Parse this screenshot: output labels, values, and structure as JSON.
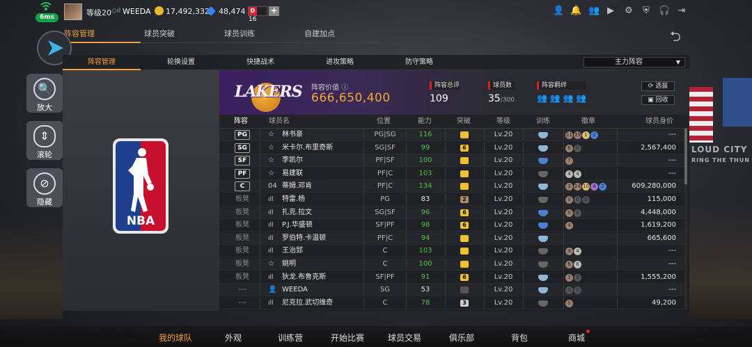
{
  "status": {
    "ping": "6ms"
  },
  "profile": {
    "level": "等级20",
    "username": "WEEDA",
    "badge_count": "16"
  },
  "currency": {
    "gold": "17,492,332",
    "diamonds": "48,474"
  },
  "main_tabs": [
    "阵容管理",
    "球员突破",
    "球员训练",
    "自建加点"
  ],
  "side_buttons": {
    "zoom": "放大",
    "scroll": "滚轮",
    "hide": "隐藏"
  },
  "sub_tabs": [
    "阵容管理",
    "轮换设置",
    "快捷战术",
    "进攻策略",
    "防守策略"
  ],
  "lineup_select": "主力阵容",
  "team": {
    "logo_text": "LAKERS",
    "value_label": "阵容价值",
    "value": "666,650,400",
    "rating_label": "阵容总评",
    "rating": "109",
    "count_label": "球员数",
    "count": "35",
    "count_max": "/300",
    "bond_label": "阵容羁绊",
    "btn_select": "选拔",
    "btn_recycle": "回收"
  },
  "table": {
    "headers": [
      "阵容",
      "球员名",
      "位置",
      "能力",
      "突破",
      "等级",
      "训练",
      "徽章",
      "球员身价"
    ],
    "rows": [
      {
        "slot": "PG",
        "tier": "☆",
        "name": "林书豪",
        "pos": "PG|SG",
        "ovr": "116",
        "ovr_color": "#52c24a",
        "brk": "",
        "brk_color": "#f0c030",
        "lv": "Lv.20",
        "train": "#8fb6d6",
        "badges": [
          [
            "11",
            "#9a8070"
          ],
          [
            "19",
            "#9a8070"
          ],
          [
            "1",
            "#d8c070"
          ],
          [
            "2",
            "#4a80d0"
          ]
        ],
        "price": "---"
      },
      {
        "slot": "SG",
        "tier": "☆",
        "name": "米卡尔.布里奇斯",
        "pos": "SG|SF",
        "ovr": "99",
        "ovr_color": "#52c24a",
        "brk": "6",
        "brk_color": "#f0c030",
        "lv": "Lv.20",
        "train": "#8fb6d6",
        "badges": [
          [
            "8",
            "#9a8070"
          ],
          [
            "0",
            "#555"
          ]
        ],
        "price": "2,567,400"
      },
      {
        "slot": "SF",
        "tier": "☆",
        "name": "李凯尔",
        "pos": "PF|SF",
        "ovr": "100",
        "ovr_color": "#52c24a",
        "brk": "",
        "brk_color": "#f0c030",
        "lv": "Lv.20",
        "train": "#4a80d0",
        "badges": [
          [
            "7",
            "#9a8070"
          ]
        ],
        "price": "---"
      },
      {
        "slot": "PF",
        "tier": "☆",
        "name": "易建联",
        "pos": "PF|C",
        "ovr": "103",
        "ovr_color": "#52c24a",
        "brk": "",
        "brk_color": "#f0c030",
        "lv": "Lv.20",
        "train": "#666",
        "badges": [
          [
            "4",
            "#bbb"
          ],
          [
            "4",
            "#bbb"
          ]
        ],
        "price": "---"
      },
      {
        "slot": "C",
        "tier": "04",
        "name": "蒂姆.邓肯",
        "pos": "PF|C",
        "ovr": "134",
        "ovr_color": "#52c24a",
        "brk": "",
        "brk_color": "#f0c030",
        "lv": "Lv.20",
        "train": "#8fb6d6",
        "badges": [
          [
            "3",
            "#9a8070"
          ],
          [
            "24",
            "#9a8070"
          ],
          [
            "10",
            "#d8c070"
          ],
          [
            "4",
            "#a070d0"
          ],
          [
            "2",
            "#4a80d0"
          ]
        ],
        "price": "609,280,000"
      },
      {
        "slot": "板凳",
        "tier": "bar",
        "name": "特雷.杨",
        "pos": "PG",
        "ovr": "83",
        "ovr_color": "#e8e8e8",
        "brk": "2",
        "brk_color": "#b08a60",
        "lv": "Lv.20",
        "train": "#666",
        "badges": [
          [
            "0",
            "#9a8070"
          ],
          [
            "0",
            "#555"
          ],
          [
            "0",
            "#4a5060"
          ]
        ],
        "price": "115,000"
      },
      {
        "slot": "板凳",
        "tier": "bar",
        "name": "扎克.拉文",
        "pos": "SG|SF",
        "ovr": "96",
        "ovr_color": "#52c24a",
        "brk": "6",
        "brk_color": "#f0c030",
        "lv": "Lv.20",
        "train": "#4a80d0",
        "badges": [
          [
            "0",
            "#9a8070"
          ],
          [
            "0",
            "#555"
          ]
        ],
        "price": "4,448,000"
      },
      {
        "slot": "板凳",
        "tier": "bar",
        "name": "P.J.华盛顿",
        "pos": "SF|PF",
        "ovr": "98",
        "ovr_color": "#52c24a",
        "brk": "6",
        "brk_color": "#f0c030",
        "lv": "Lv.20",
        "train": "#4a80d0",
        "badges": [
          [
            "4",
            "#9a8070"
          ]
        ],
        "price": "1,619,200"
      },
      {
        "slot": "板凳",
        "tier": "bar",
        "name": "罗伯特.卡温顿",
        "pos": "PF|C",
        "ovr": "94",
        "ovr_color": "#52c24a",
        "brk": "",
        "brk_color": "#f0c030",
        "lv": "Lv.20",
        "train": "#8fb6d6",
        "badges": [],
        "price": "665,600"
      },
      {
        "slot": "板凳",
        "tier": "bar",
        "name": "王治郅",
        "pos": "C",
        "ovr": "103",
        "ovr_color": "#52c24a",
        "brk": "",
        "brk_color": "#f0c030",
        "lv": "Lv.20",
        "train": "#666",
        "badges": [
          [
            "4",
            "#9a8070"
          ],
          [
            "4",
            "#bbb"
          ]
        ],
        "price": "---"
      },
      {
        "slot": "板凳",
        "tier": "☆",
        "name": "姚明",
        "pos": "C",
        "ovr": "100",
        "ovr_color": "#52c24a",
        "brk": "",
        "brk_color": "#f0c030",
        "lv": "Lv.20",
        "train": "#666",
        "badges": [
          [
            "6",
            "#9a8070"
          ],
          [
            "6",
            "#bbb"
          ]
        ],
        "price": "---"
      },
      {
        "slot": "板凳",
        "tier": "bar",
        "name": "狄龙.布鲁克斯",
        "pos": "SF|PF",
        "ovr": "91",
        "ovr_color": "#52c24a",
        "brk": "6",
        "brk_color": "#f0c030",
        "lv": "Lv.20",
        "train": "#8fb6d6",
        "badges": [
          [
            "3",
            "#9a8070"
          ],
          [
            "0",
            "#555"
          ]
        ],
        "price": "1,555,200"
      },
      {
        "slot": "---",
        "tier": "👤",
        "name": "WEEDA",
        "pos": "SG",
        "ovr": "53",
        "ovr_color": "#e8e8e8",
        "brk": "",
        "brk_color": "#555",
        "lv": "Lv.20",
        "train": "#8fb6d6",
        "badges": [
          [
            "0",
            "#555"
          ],
          [
            "0",
            "#4a5060"
          ]
        ],
        "price": "---"
      },
      {
        "slot": "---",
        "tier": "bar",
        "name": "尼克拉.武切维奇",
        "pos": "C",
        "ovr": "78",
        "ovr_color": "#52c24a",
        "brk": "3",
        "brk_color": "#ccc",
        "lv": "Lv.20",
        "train": "#666",
        "badges": [
          [
            "0",
            "#9a8070"
          ]
        ],
        "price": "49,200"
      }
    ]
  },
  "bottom_nav": [
    "我的球队",
    "外观",
    "训练营",
    "开始比赛",
    "球员交易",
    "俱乐部",
    "背包",
    "商城"
  ],
  "arena": {
    "side_text": "LOUD CITY",
    "side_sub": "RING THE THUN"
  }
}
